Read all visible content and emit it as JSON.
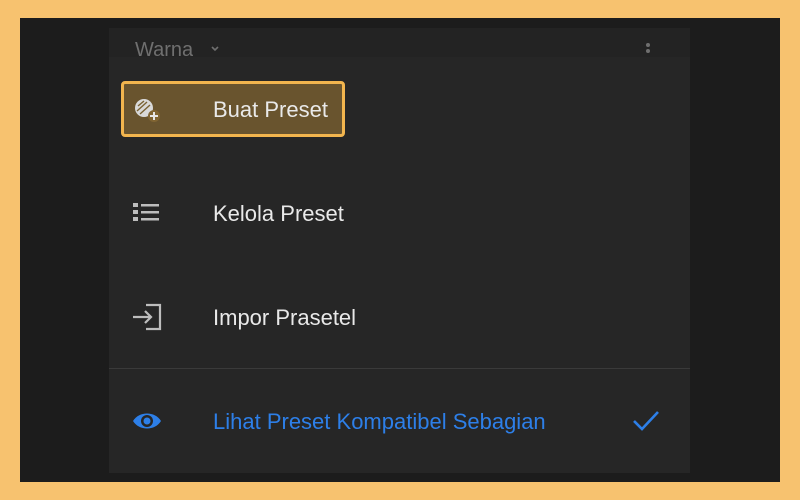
{
  "header": {
    "title": "Warna",
    "chevron_icon": "chevron-down-icon",
    "more_icon": "kebab-menu-icon"
  },
  "menu": {
    "items": [
      {
        "label": "Buat Preset",
        "icon": "create-preset-icon",
        "highlighted": true
      },
      {
        "label": "Kelola Preset",
        "icon": "list-icon"
      },
      {
        "label": "Impor Prasetel",
        "icon": "import-icon"
      },
      {
        "label": "Lihat Preset Kompatibel Sebagian",
        "icon": "eye-icon",
        "checked": true,
        "check_icon": "checkmark-icon"
      }
    ]
  },
  "colors": {
    "frame": "#F7C26F",
    "highlight_border": "#F2B54E",
    "menu_background": "#262626",
    "accent_blue": "#2D7FE8",
    "text": "#E9E9E9"
  }
}
